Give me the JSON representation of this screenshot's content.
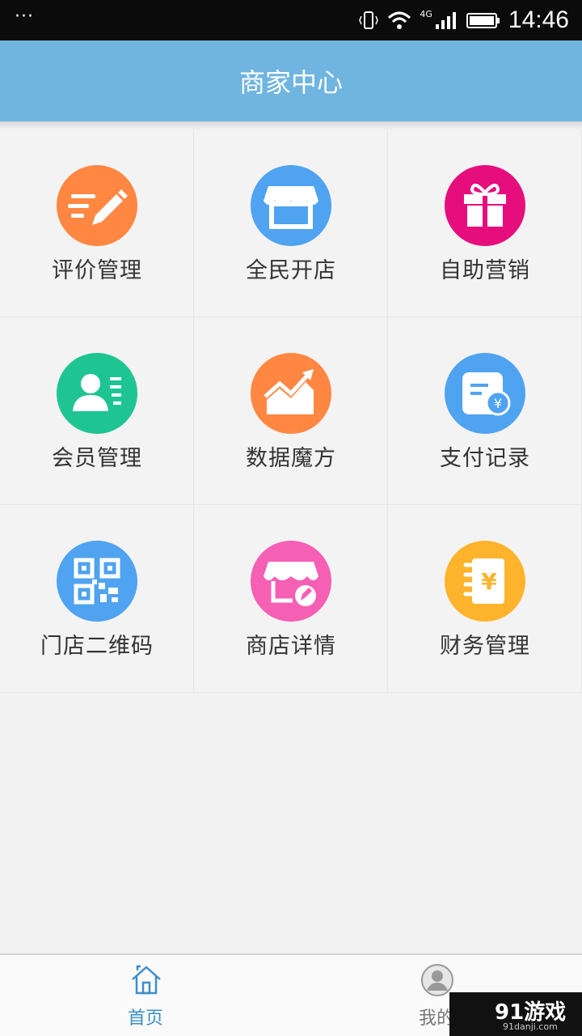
{
  "status_bar": {
    "menu_dots": "···",
    "network": "4G",
    "time": "14:46"
  },
  "header": {
    "title": "商家中心"
  },
  "grid": [
    {
      "label": "评价管理",
      "icon": "pencil-note-icon",
      "color": "#ff8742"
    },
    {
      "label": "全民开店",
      "icon": "storefront-icon",
      "color": "#4fa3f0"
    },
    {
      "label": "自助营销",
      "icon": "gift-icon",
      "color": "#e60e7d"
    },
    {
      "label": "会员管理",
      "icon": "member-card-icon",
      "color": "#1ec592"
    },
    {
      "label": "数据魔方",
      "icon": "trend-chart-icon",
      "color": "#ff8742"
    },
    {
      "label": "支付记录",
      "icon": "payment-record-icon",
      "color": "#4fa3f0"
    },
    {
      "label": "门店二维码",
      "icon": "qr-code-icon",
      "color": "#4fa3f0"
    },
    {
      "label": "商店详情",
      "icon": "store-edit-icon",
      "color": "#f55fb4"
    },
    {
      "label": "财务管理",
      "icon": "finance-book-icon",
      "color": "#fdb42c"
    }
  ],
  "tabs": [
    {
      "label": "首页",
      "icon": "home-icon",
      "active": true
    },
    {
      "label": "我的",
      "icon": "user-avatar-icon",
      "active": false
    }
  ],
  "watermark": {
    "logo": "91游戏",
    "site": "91danji.com"
  },
  "colors": {
    "header": "#6fb5e0",
    "active_tab": "#3d8ec8"
  }
}
